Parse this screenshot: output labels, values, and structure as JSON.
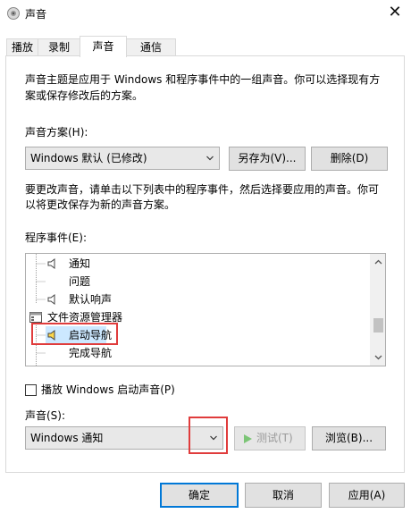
{
  "window": {
    "title": "声音",
    "close_glyph": "✕"
  },
  "tabs": [
    {
      "label": "播放",
      "active": false
    },
    {
      "label": "录制",
      "active": false
    },
    {
      "label": "声音",
      "active": true
    },
    {
      "label": "通信",
      "active": false
    }
  ],
  "intro_line1": "声音主题是应用于 Windows 和程序事件中的一组声音。你可以选择现有方",
  "intro_line2": "案或保存修改后的方案。",
  "scheme": {
    "label": "声音方案(H):",
    "value": "Windows 默认 (已修改)",
    "save_as_label": "另存为(V)...",
    "delete_label": "删除(D)"
  },
  "instructions_line1": "要更改声音，请单击以下列表中的程序事件，然后选择要应用的声音。你可",
  "instructions_line2": "以将更改保存为新的声音方案。",
  "events": {
    "label": "程序事件(E):",
    "items": [
      {
        "label": "通知",
        "has_sound": true,
        "selected": false,
        "category": false
      },
      {
        "label": "问题",
        "has_sound": false,
        "selected": false,
        "category": false
      },
      {
        "label": "默认响声",
        "has_sound": true,
        "selected": false,
        "category": false
      },
      {
        "label": "文件资源管理器",
        "has_sound": false,
        "selected": false,
        "category": true
      },
      {
        "label": "启动导航",
        "has_sound": true,
        "selected": true,
        "category": false
      },
      {
        "label": "完成导航",
        "has_sound": false,
        "selected": false,
        "category": false
      }
    ]
  },
  "startup_checkbox": {
    "label": "播放 Windows 启动声音(P)",
    "checked": false
  },
  "sound": {
    "label": "声音(S):",
    "value": "Windows 通知",
    "test_label": "测试(T)",
    "browse_label": "浏览(B)..."
  },
  "footer": {
    "ok_label": "确定",
    "cancel_label": "取消",
    "apply_label": "应用(A)"
  },
  "colors": {
    "accent": "#0078d7",
    "highlight_box": "#e03c3c",
    "selection": "#cce8ff"
  }
}
